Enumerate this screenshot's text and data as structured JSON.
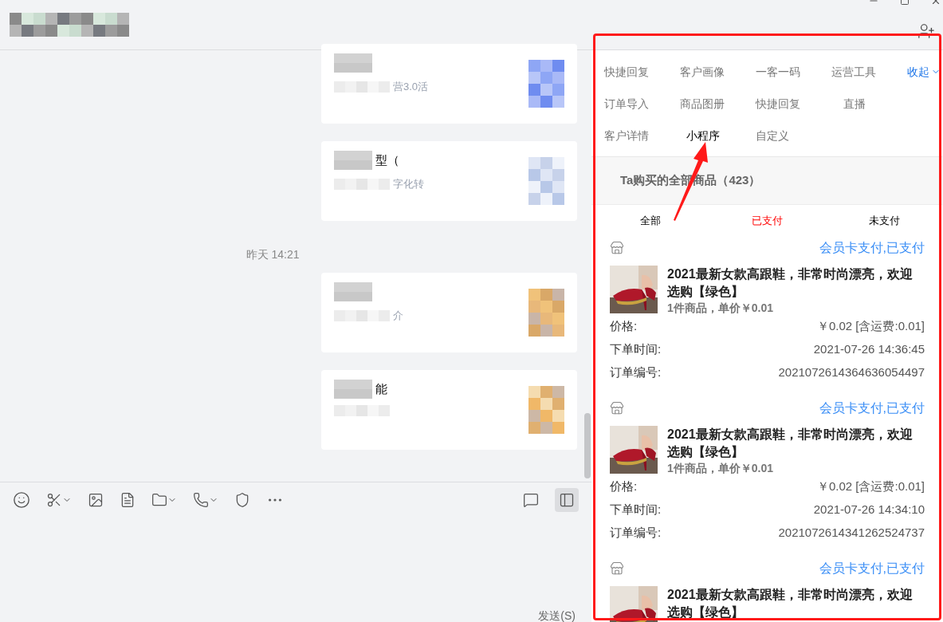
{
  "chat": {
    "timestamp": "昨天 14:21",
    "cards": [
      {
        "desc_fragment": "营3.0活"
      },
      {
        "title_fragment": "型（",
        "desc_fragment": "字化转"
      },
      {
        "desc_fragment": "介"
      },
      {
        "title_fragment": "能"
      }
    ],
    "send_label": "发送(S)",
    "sidebar_open": true
  },
  "sidebar": {
    "tools": [
      {
        "label": "快捷回复",
        "selected": false
      },
      {
        "label": "客户画像",
        "selected": false
      },
      {
        "label": "一客一码",
        "selected": false
      },
      {
        "label": "运营工具",
        "selected": false
      },
      {
        "label": "订单导入",
        "selected": false
      },
      {
        "label": "商品图册",
        "selected": false
      },
      {
        "label": "快捷回复",
        "selected": false
      },
      {
        "label": "直播",
        "selected": false
      },
      {
        "label": "客户详情",
        "selected": false
      },
      {
        "label": "小程序",
        "selected": true
      },
      {
        "label": "自定义",
        "selected": false
      }
    ],
    "collapse_label": "收起",
    "section_title": "Ta购买的全部商品（423）",
    "filters": [
      {
        "label": "全部",
        "selected": false
      },
      {
        "label": "已支付",
        "selected": true
      },
      {
        "label": "未支付",
        "selected": false
      }
    ],
    "orders": [
      {
        "status": "会员卡支付,已支付",
        "title": "2021最新女款高跟鞋，非常时尚漂亮，欢迎选购【绿色】",
        "subtitle": "1件商品，单价￥0.01",
        "fields": [
          {
            "label": "价格:",
            "value": "￥0.02 [含运费:0.01]"
          },
          {
            "label": "下单时间:",
            "value": "2021-07-26 14:36:45"
          },
          {
            "label": "订单编号:",
            "value": "2021072614364636054497"
          }
        ]
      },
      {
        "status": "会员卡支付,已支付",
        "title": "2021最新女款高跟鞋，非常时尚漂亮，欢迎选购【绿色】",
        "subtitle": "1件商品，单价￥0.01",
        "fields": [
          {
            "label": "价格:",
            "value": "￥0.02 [含运费:0.01]"
          },
          {
            "label": "下单时间:",
            "value": "2021-07-26 14:34:10"
          },
          {
            "label": "订单编号:",
            "value": "2021072614341262524737"
          }
        ]
      },
      {
        "status": "会员卡支付,已支付",
        "title": "2021最新女款高跟鞋，非常时尚漂亮，欢迎选购【绿色】"
      }
    ]
  }
}
